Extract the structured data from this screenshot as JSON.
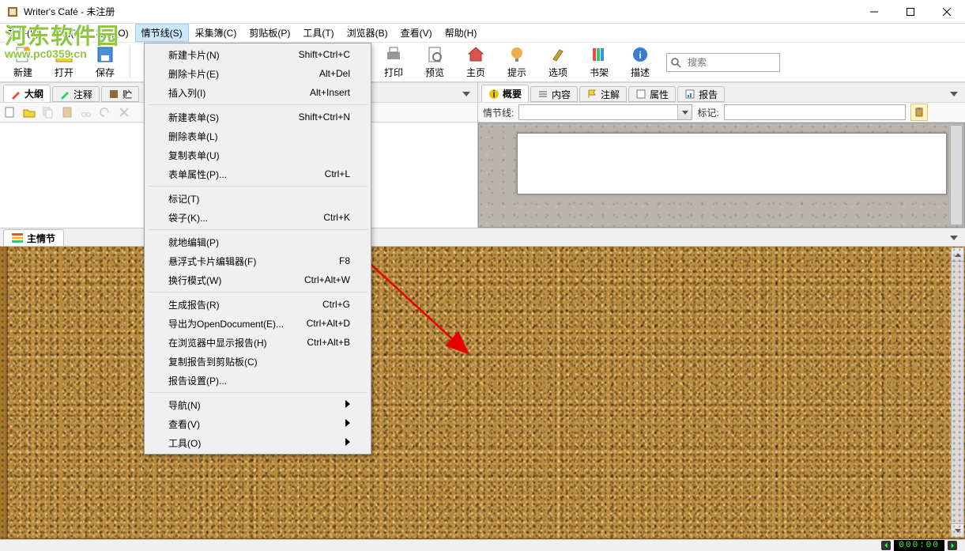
{
  "title": "Writer's Café - 未注册",
  "watermark": {
    "text": "河东软件园",
    "url": "www.pc0359.cn"
  },
  "menubar": [
    "文件(F)",
    "编辑(E)",
    "格式(O)",
    "情节线(S)",
    "采集簿(C)",
    "剪贴板(P)",
    "工具(T)",
    "浏览器(B)",
    "查看(V)",
    "帮助(H)"
  ],
  "menubar_active_index": 3,
  "toolbar": {
    "left": [
      {
        "name": "new",
        "label": "新建",
        "color": "#f2a93b"
      },
      {
        "name": "open",
        "label": "打开",
        "color": "#f2d33b"
      },
      {
        "name": "save",
        "label": "保存",
        "color": "#4a90d9"
      }
    ],
    "right": [
      {
        "name": "print",
        "label": "打印",
        "color": "#777"
      },
      {
        "name": "preview",
        "label": "预览",
        "color": "#777"
      },
      {
        "name": "home",
        "label": "主页",
        "color": "#d9534f"
      },
      {
        "name": "tips",
        "label": "提示",
        "color": "#f0ad4e"
      },
      {
        "name": "options",
        "label": "选项",
        "color": "#c9a227"
      },
      {
        "name": "bookshelf",
        "label": "书架",
        "color": "#2d7"
      },
      {
        "name": "describe",
        "label": "描述",
        "color": "#3a7bd5"
      }
    ],
    "search_placeholder": "搜索"
  },
  "left_tabs": [
    {
      "name": "outline",
      "label": "大纲",
      "icon": "pencil-red",
      "active": true
    },
    {
      "name": "annotation",
      "label": "注释",
      "icon": "pencil-green"
    },
    {
      "name": "storage",
      "label": "贮",
      "icon": "book"
    }
  ],
  "right_tabs": [
    {
      "name": "summary",
      "label": "概要",
      "icon": "info-yellow",
      "active": true
    },
    {
      "name": "content",
      "label": "内容",
      "icon": "lines"
    },
    {
      "name": "annotate",
      "label": "注解",
      "icon": "flag"
    },
    {
      "name": "properties",
      "label": "属性",
      "icon": "sheet"
    },
    {
      "name": "report",
      "label": "报告",
      "icon": "report"
    }
  ],
  "right_controls": {
    "plotline_label": "情节线:",
    "mark_label": "标记:"
  },
  "plot_tab": "主情节",
  "status": {
    "lcd": "000:00"
  },
  "dropdown": {
    "groups": [
      [
        {
          "label": "新建卡片(N)",
          "shortcut": "Shift+Ctrl+C"
        },
        {
          "label": "删除卡片(E)",
          "shortcut": "Alt+Del"
        },
        {
          "label": "插入列(I)",
          "shortcut": "Alt+Insert"
        }
      ],
      [
        {
          "label": "新建表单(S)",
          "shortcut": "Shift+Ctrl+N"
        },
        {
          "label": "删除表单(L)"
        },
        {
          "label": "复制表单(U)"
        },
        {
          "label": "表单属性(P)...",
          "shortcut": "Ctrl+L"
        }
      ],
      [
        {
          "label": "标记(T)"
        },
        {
          "label": "袋子(K)...",
          "shortcut": "Ctrl+K"
        }
      ],
      [
        {
          "label": "就地编辑(P)"
        },
        {
          "label": "悬浮式卡片编辑器(F)",
          "shortcut": "F8"
        },
        {
          "label": "换行模式(W)",
          "shortcut": "Ctrl+Alt+W"
        }
      ],
      [
        {
          "label": "生成报告(R)",
          "shortcut": "Ctrl+G"
        },
        {
          "label": "导出为OpenDocument(E)...",
          "shortcut": "Ctrl+Alt+D"
        },
        {
          "label": "在浏览器中显示报告(H)",
          "shortcut": "Ctrl+Alt+B"
        },
        {
          "label": "复制报告到剪贴板(C)"
        },
        {
          "label": "报告设置(P)..."
        }
      ],
      [
        {
          "label": "导航(N)",
          "submenu": true
        },
        {
          "label": "查看(V)",
          "submenu": true
        },
        {
          "label": "工具(O)",
          "submenu": true
        }
      ]
    ]
  }
}
